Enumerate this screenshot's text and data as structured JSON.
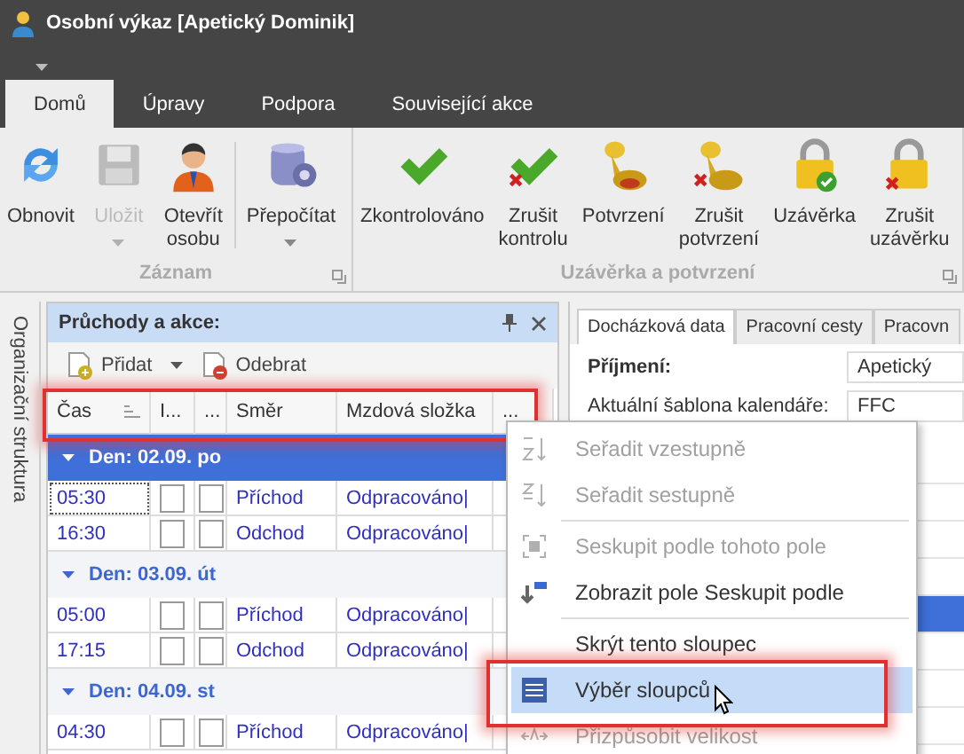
{
  "window": {
    "title": "Osobní výkaz [Apetický Dominik]"
  },
  "ribbon_tabs": [
    {
      "label": "Domů",
      "selected": true
    },
    {
      "label": "Úpravy",
      "selected": false
    },
    {
      "label": "Podpora",
      "selected": false
    },
    {
      "label": "Související akce",
      "selected": false
    }
  ],
  "ribbon_groups": [
    {
      "label": "Záznam",
      "sections": [
        [
          {
            "label": "Obnovit",
            "kind": "refresh",
            "disabled": false,
            "dropdown": false
          },
          {
            "label": "Uložit",
            "kind": "save",
            "disabled": true,
            "dropdown": true
          },
          {
            "label": "Otevřít\nosobu",
            "kind": "person",
            "disabled": false,
            "dropdown": false
          }
        ],
        [
          {
            "label": "Přepočítat",
            "kind": "database",
            "disabled": false,
            "dropdown": true
          }
        ]
      ]
    },
    {
      "label": "Uzávěrka a potvrzení",
      "sections": [
        [
          {
            "label": "Zkontrolováno",
            "kind": "check",
            "disabled": false,
            "dropdown": false
          },
          {
            "label": "Zrušit\nkontrolu",
            "kind": "check-cancel",
            "disabled": false,
            "dropdown": false
          },
          {
            "label": "Potvrzení",
            "kind": "stamp",
            "disabled": false,
            "dropdown": false
          },
          {
            "label": "Zrušit\npotvrzení",
            "kind": "stamp-cancel",
            "disabled": false,
            "dropdown": false
          },
          {
            "label": "Uzávěrka",
            "kind": "lock",
            "disabled": false,
            "dropdown": false
          },
          {
            "label": "Zrušit\nuzávěrku",
            "kind": "lock-cancel",
            "disabled": false,
            "dropdown": false
          }
        ]
      ]
    }
  ],
  "side_strip": {
    "label": "Organizační struktura"
  },
  "passages_panel": {
    "title": "Průchody a akce:",
    "toolbar": [
      {
        "label": "Přidat",
        "dropdown": true
      },
      {
        "label": "Odebrat",
        "dropdown": false
      }
    ],
    "columns": [
      "Čas",
      "I...",
      "...",
      "Směr",
      "Mzdová složka",
      "..."
    ],
    "groups": [
      {
        "label": "Den: 02.09. po",
        "selected": true,
        "rows": [
          {
            "cells": [
              {
                "kind": "text",
                "text": "05:30",
                "focused": true
              },
              {
                "kind": "checkbox",
                "checked": false
              },
              {
                "kind": "checkbox",
                "checked": false
              },
              {
                "kind": "text",
                "text": "Příchod",
                "focused": false
              },
              {
                "kind": "text",
                "text": "Odpracováno|",
                "focused": false
              }
            ]
          },
          {
            "cells": [
              {
                "kind": "text",
                "text": "16:30",
                "focused": false
              },
              {
                "kind": "checkbox",
                "checked": false
              },
              {
                "kind": "checkbox",
                "checked": false
              },
              {
                "kind": "text",
                "text": "Odchod",
                "focused": false
              },
              {
                "kind": "text",
                "text": "Odpracováno|",
                "focused": false
              }
            ]
          }
        ]
      },
      {
        "label": "Den: 03.09. út",
        "selected": false,
        "rows": [
          {
            "cells": [
              {
                "kind": "text",
                "text": "05:00",
                "focused": false
              },
              {
                "kind": "checkbox",
                "checked": false
              },
              {
                "kind": "checkbox",
                "checked": false
              },
              {
                "kind": "text",
                "text": "Příchod",
                "focused": false
              },
              {
                "kind": "text",
                "text": "Odpracováno|",
                "focused": false
              }
            ]
          },
          {
            "cells": [
              {
                "kind": "text",
                "text": "17:15",
                "focused": false
              },
              {
                "kind": "checkbox",
                "checked": false
              },
              {
                "kind": "checkbox",
                "checked": false
              },
              {
                "kind": "text",
                "text": "Odchod",
                "focused": false
              },
              {
                "kind": "text",
                "text": "Odpracováno|",
                "focused": false
              }
            ]
          }
        ]
      },
      {
        "label": "Den: 04.09. st",
        "selected": false,
        "rows": [
          {
            "cells": [
              {
                "kind": "text",
                "text": "04:30",
                "focused": false
              },
              {
                "kind": "checkbox",
                "checked": false
              },
              {
                "kind": "checkbox",
                "checked": false
              },
              {
                "kind": "text",
                "text": "Příchod",
                "focused": false
              },
              {
                "kind": "text",
                "text": "Odpracováno|",
                "focused": false
              }
            ]
          }
        ]
      }
    ]
  },
  "detail_panel": {
    "tabs": [
      {
        "label": "Docházková data",
        "selected": true
      },
      {
        "label": "Pracovní cesty",
        "selected": false
      },
      {
        "label": "Pracovn",
        "selected": false
      }
    ],
    "fields": [
      {
        "label": "Příjmení:",
        "value": "Apetický"
      },
      {
        "label": "Aktuální šablona kalendáře:",
        "value": "FFC"
      }
    ]
  },
  "context_menu": {
    "items": [
      {
        "kind": "item",
        "label": "Seřadit vzestupně",
        "disabled": true,
        "selected": false
      },
      {
        "kind": "item",
        "label": "Seřadit sestupně",
        "disabled": true,
        "selected": false
      },
      {
        "kind": "separator"
      },
      {
        "kind": "item",
        "label": "Seskupit podle tohoto pole",
        "disabled": true,
        "selected": false
      },
      {
        "kind": "item",
        "label": "Zobrazit pole Seskupit podle",
        "disabled": false,
        "selected": false
      },
      {
        "kind": "separator"
      },
      {
        "kind": "item",
        "label": "Skrýt tento sloupec",
        "disabled": false,
        "selected": false
      },
      {
        "kind": "item",
        "label": "Výběr sloupců",
        "disabled": false,
        "selected": true
      },
      {
        "kind": "item",
        "label": "Přizpůsobit velikost",
        "disabled": true,
        "selected": false
      }
    ]
  }
}
